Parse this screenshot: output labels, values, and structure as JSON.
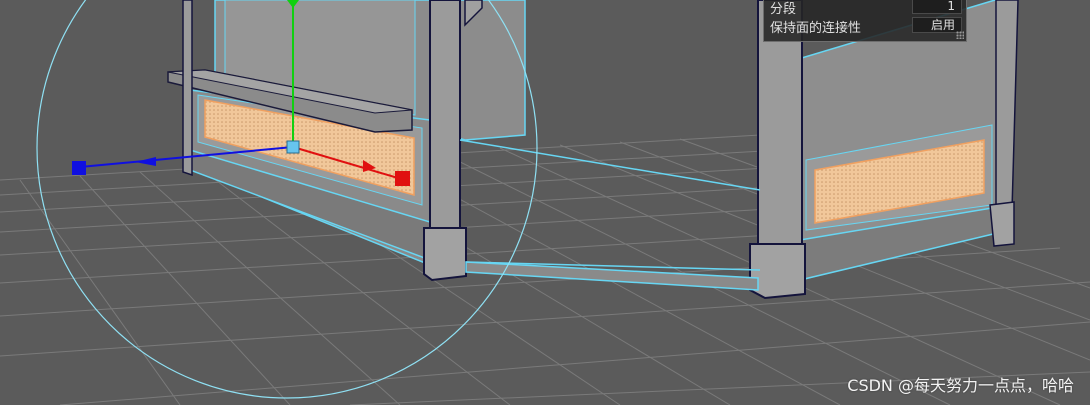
{
  "hud": {
    "rows": [
      {
        "label": "分段",
        "value": "1"
      },
      {
        "label": "保持面的连接性",
        "value": "启用"
      }
    ]
  },
  "watermark": "CSDN @每天努力一点点，哈哈",
  "colors": {
    "background": "#5b5b5b",
    "grid": "#7c7c7c",
    "selection": "#67d6f3",
    "face_highlight": "#f0a060",
    "axis_x": "#e01010",
    "axis_y": "#10d010",
    "axis_z": "#1010e0",
    "manipulator_ring": "#8fe0f3"
  },
  "icons": {
    "hud_resize": "resize-grip-icon",
    "move_tool": "move-manipulator-icon"
  }
}
